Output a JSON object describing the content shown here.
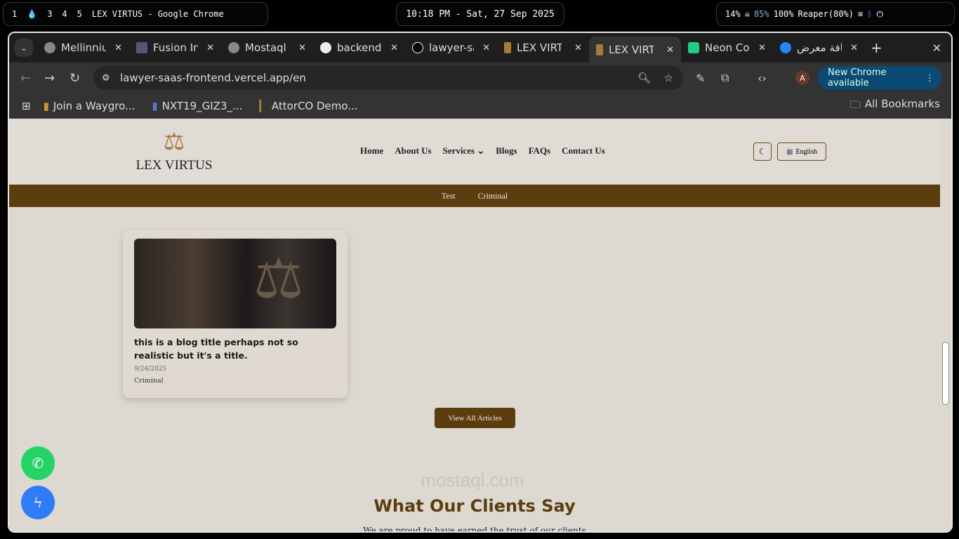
{
  "desktop": {
    "workspaces": [
      "1",
      "3",
      "4",
      "5"
    ],
    "window_title": "LEX VIRTUS - Google Chrome",
    "clock": "10:18 PM - Sat, 27 Sep 2025",
    "status": {
      "cpu": "14%",
      "mem": "85%",
      "battery": "100%",
      "power_profile": "Reaper(80%)"
    }
  },
  "browser": {
    "tabs": [
      {
        "label": "Mellinnium"
      },
      {
        "label": "Fusion Integration"
      },
      {
        "label": "Mostaql"
      },
      {
        "label": "backend"
      },
      {
        "label": "lawyer-saas"
      },
      {
        "label": "LEX VIRTUS"
      },
      {
        "label": "LEX VIRTUS",
        "active": true
      },
      {
        "label": "Neon Console"
      },
      {
        "label": "إضافة معرض"
      }
    ],
    "url": "lawyer-saas-frontend.vercel.app/en",
    "profile_initial": "A",
    "update_label": "New Chrome available",
    "bookmarks": [
      "Join a Waygro...",
      "NXT19_GIZ3_...",
      "AttorCO Demo..."
    ],
    "all_bookmarks": "All Bookmarks"
  },
  "site": {
    "logo": "LEX VIRTUS",
    "nav": [
      "Home",
      "About Us",
      "Blogs",
      "FAQs",
      "Contact Us"
    ],
    "services": "Services",
    "language": "English",
    "categories": [
      "Test",
      "Criminal"
    ],
    "blog": {
      "title": "this is a blog title perhaps not so realistic but it's a title.",
      "date": "9/24/2025",
      "category": "Criminal"
    },
    "view_all": "View All Articles",
    "testimonials_title": "What Our Clients Say",
    "testimonials_sub": "We are proud to have earned the trust of our clients",
    "watermark": "mostaql.com"
  }
}
